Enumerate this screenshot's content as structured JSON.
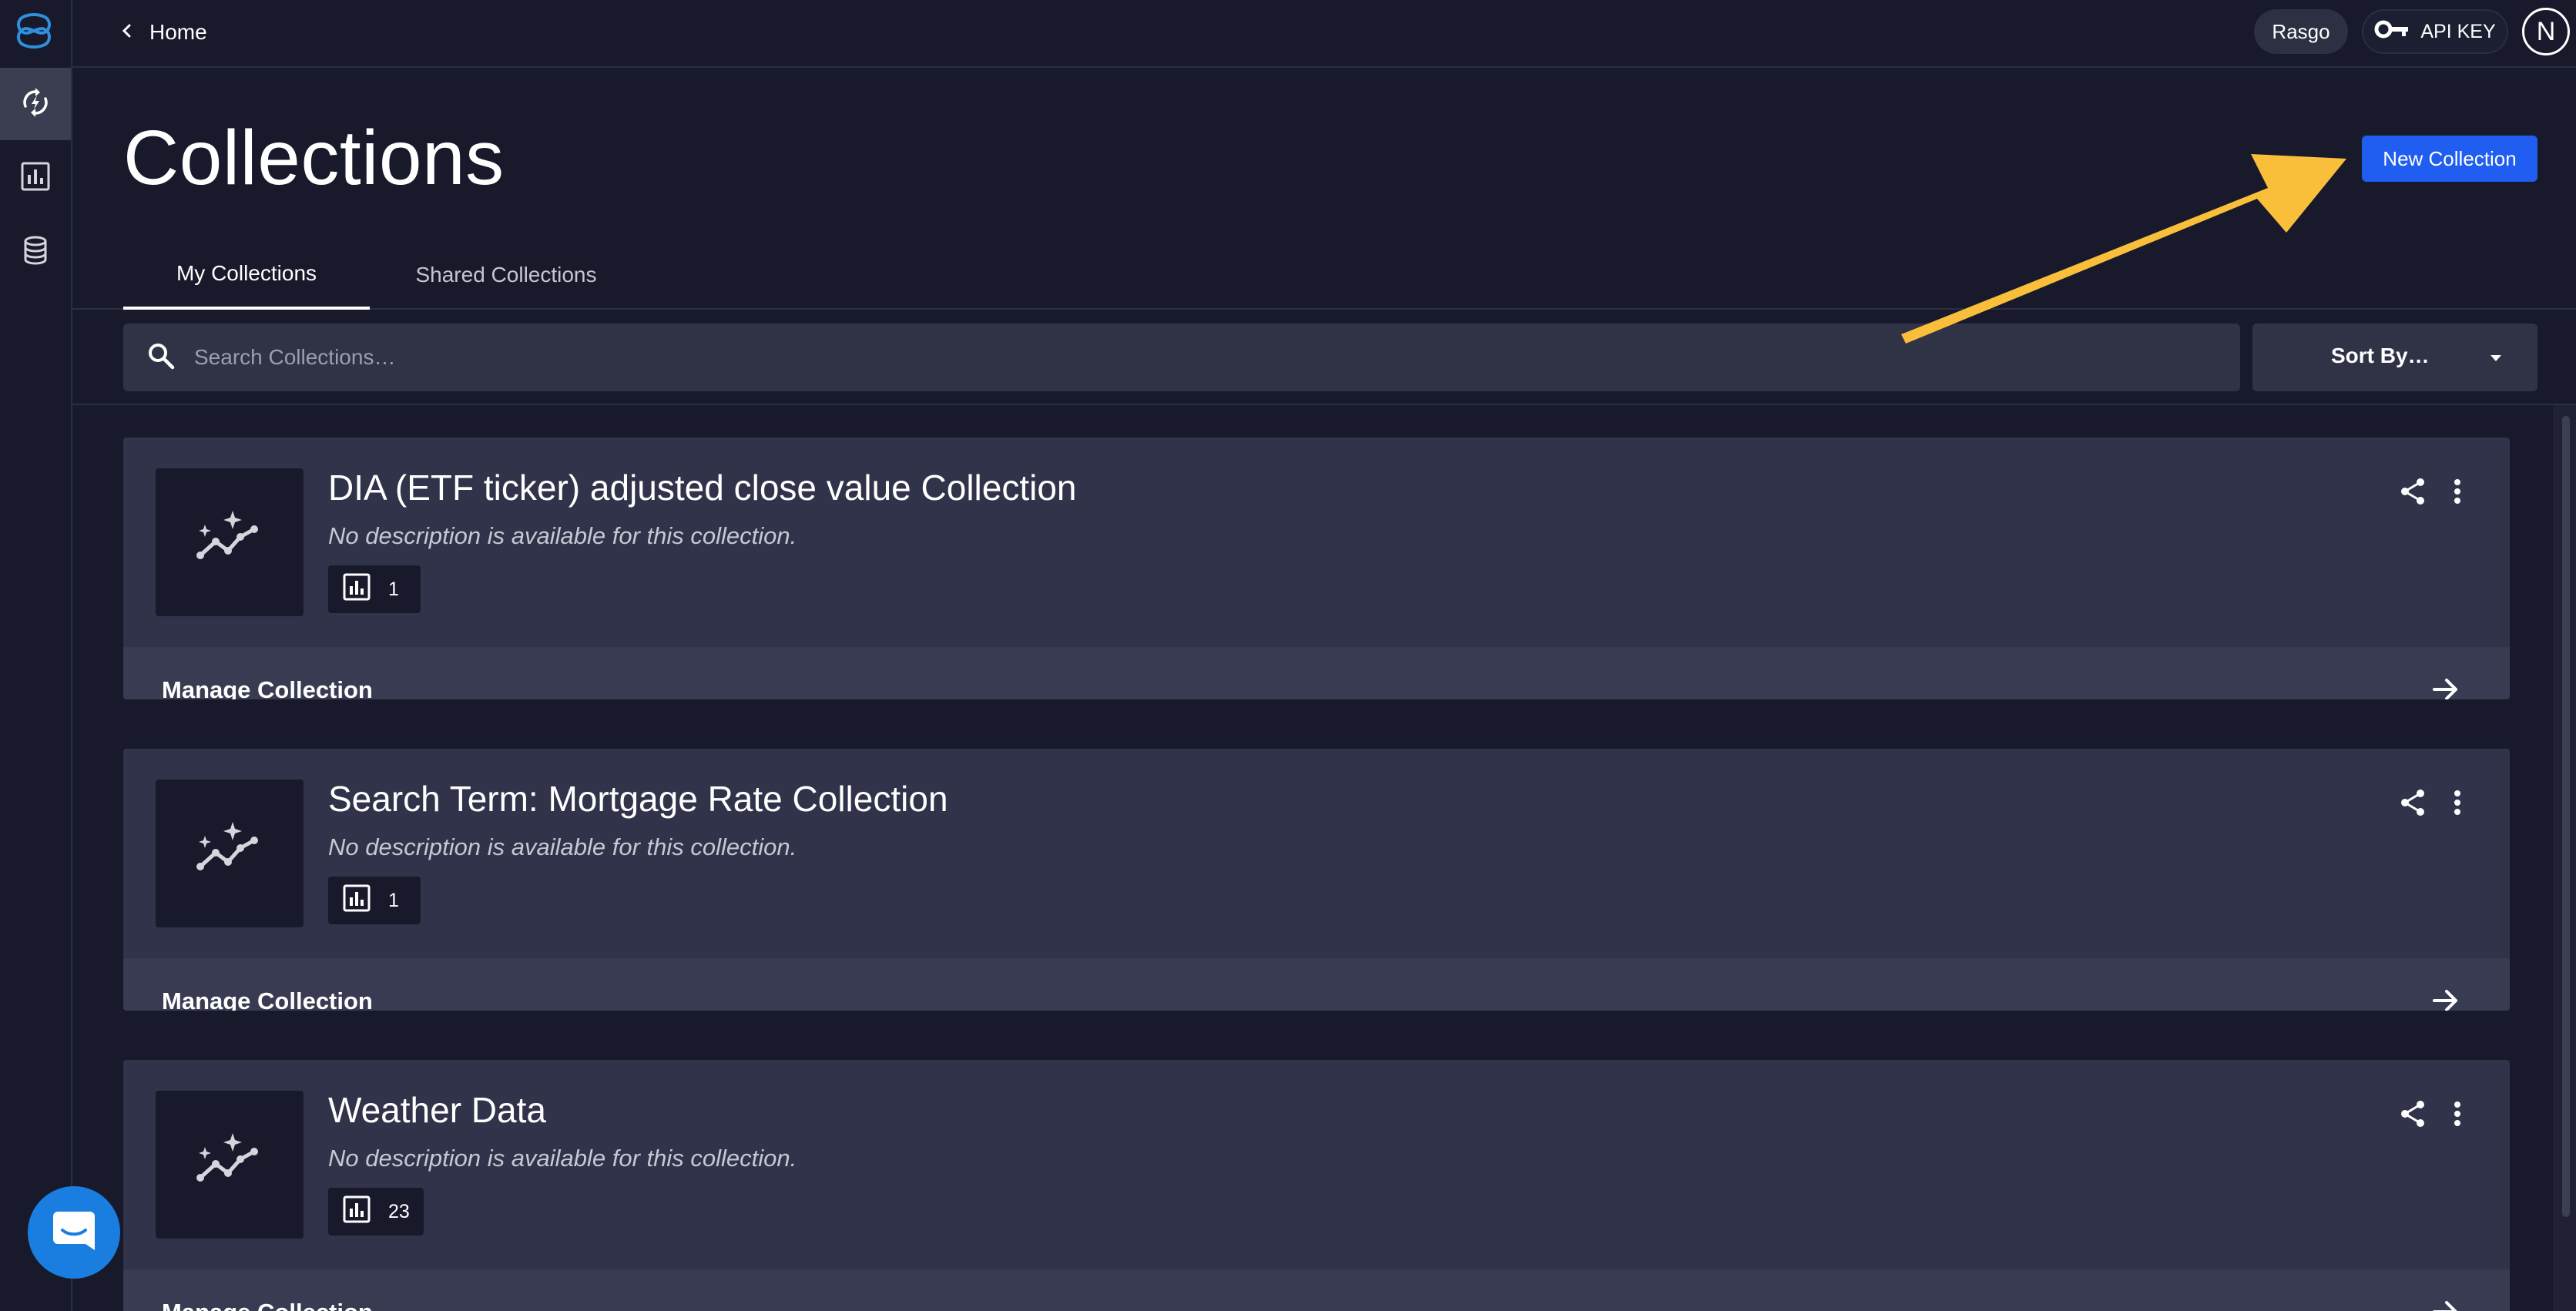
{
  "topbar": {
    "back_label": "Home",
    "workspace_label": "Rasgo",
    "api_key_label": "API KEY",
    "avatar_initial": "N"
  },
  "page": {
    "title": "Collections",
    "new_button_label": "New Collection"
  },
  "tabs": [
    {
      "label": "My Collections",
      "active": true
    },
    {
      "label": "Shared Collections",
      "active": false
    }
  ],
  "search": {
    "placeholder": "Search Collections…",
    "value": ""
  },
  "sort": {
    "label": "Sort By…"
  },
  "collections": [
    {
      "title": "DIA (ETF ticker) adjusted close value Collection",
      "description": "No description is available for this collection.",
      "count": "1",
      "manage_label": "Manage Collection"
    },
    {
      "title": "Search Term: Mortgage Rate Collection",
      "description": "No description is available for this collection.",
      "count": "1",
      "manage_label": "Manage Collection"
    },
    {
      "title": "Weather Data",
      "description": "No description is available for this collection.",
      "count": "23",
      "manage_label": "Manage Collection"
    }
  ],
  "colors": {
    "background": "#181a2b",
    "card": "#31334a",
    "card_footer": "#383b52",
    "primary": "#1f5ef0",
    "annotation_arrow": "#f9bf3b",
    "chat_bubble": "#1a7de0"
  },
  "icons": {
    "logo": "app-logo-icon",
    "rail": [
      "metrics-refresh-icon",
      "bar-chart-icon",
      "database-icon"
    ],
    "back": "chevron-left-icon",
    "api_key": "key-icon",
    "search": "search-icon",
    "sort": "caret-down-icon",
    "card_thumb": "sparkle-trend-icon",
    "count": "bar-chart-icon",
    "share": "share-icon",
    "more": "more-vertical-icon",
    "manage": "arrow-right-icon",
    "chat": "chat-bubble-icon"
  }
}
